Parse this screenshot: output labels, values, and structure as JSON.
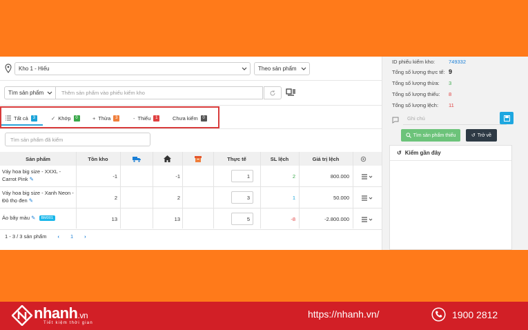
{
  "warehouse": {
    "selected": "Kho 1 - Hiếu"
  },
  "mode": {
    "selected": "Theo sản phẩm"
  },
  "product_search": {
    "type": "Tìm sản phẩm",
    "placeholder": "Thêm sản phẩm vào phiếu kiểm kho"
  },
  "tabs": [
    {
      "label": "Tất cả",
      "count": "3",
      "color": "#1aa3d9"
    },
    {
      "label": "Khớp",
      "count": "0",
      "color": "#3aa84a"
    },
    {
      "label": "Thừa",
      "count": "3",
      "color": "#f07f3c"
    },
    {
      "label": "Thiếu",
      "count": "1",
      "color": "#e04141"
    },
    {
      "label": "Chưa kiểm",
      "count": "0",
      "color": "#555555"
    }
  ],
  "checked_search": {
    "placeholder": "Tìm sản phẩm đã kiểm"
  },
  "table": {
    "headers": {
      "product": "Sản phẩm",
      "stock": "Tồn kho",
      "actual": "Thực tế",
      "diff": "SL lệch",
      "value": "Giá trị lệch"
    },
    "rows": [
      {
        "name": "Váy hoa big size - XXXL - Carrot Pink",
        "stock": "-1",
        "col_store": "-1",
        "actual": "1",
        "diff": "2",
        "diff_color": "#3aa84a",
        "value": "800.000",
        "sku": ""
      },
      {
        "name": "Váy hoa big size - Xanh Neon - Đỏ thọ đen",
        "stock": "2",
        "col_store": "2",
        "actual": "3",
        "diff": "1",
        "diff_color": "#1aa3d9",
        "value": "50.000",
        "sku": ""
      },
      {
        "name": "Áo bây màu",
        "stock": "13",
        "col_store": "13",
        "actual": "5",
        "diff": "-8",
        "diff_color": "#e04141",
        "value": "-2.800.000",
        "sku": "BM001"
      }
    ]
  },
  "pager": {
    "summary": "1 - 3 / 3 sản phẩm",
    "prev": "‹",
    "page": "1",
    "next": "›"
  },
  "stats": {
    "id_label": "ID phiếu kiểm kho:",
    "id_value": "749332",
    "actual_label": "Tổng số lượng thực tế:",
    "actual_value": "9",
    "surplus_label": "Tổng số lượng thừa:",
    "surplus_value": "3",
    "missing_label": "Tổng số lượng thiếu:",
    "missing_value": "8",
    "diff_label": "Tổng số lượng lệch:",
    "diff_value": "11"
  },
  "note": {
    "placeholder": "Ghi chú"
  },
  "buttons": {
    "find_missing": "Tìm sản phẩm thiếu",
    "back": "Trở về"
  },
  "recent": {
    "title": "Kiểm gần đây"
  },
  "footer": {
    "brand": "nhanh",
    "brand_suffix": ".vn",
    "tagline": "Tiết kiệm thời gian",
    "website": "https://nhanh.vn/",
    "phone": "1900 2812"
  }
}
